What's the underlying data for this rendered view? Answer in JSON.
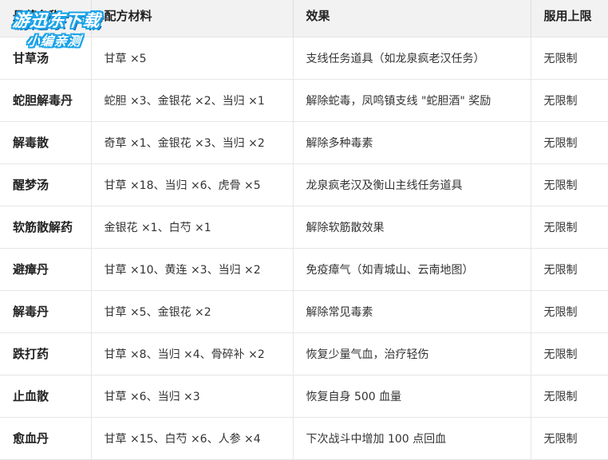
{
  "table": {
    "headers": [
      "丹药名称",
      "配方材料",
      "效果",
      "服用上限"
    ],
    "rows": [
      [
        "甘草汤",
        "甘草 ×5",
        "支线任务道具（如龙泉疯老汉任务）",
        "无限制"
      ],
      [
        "蛇胆解毒丹",
        "蛇胆 ×3、金银花 ×2、当归 ×1",
        "解除蛇毒，凤鸣镇支线 \"蛇胆酒\" 奖励",
        "无限制"
      ],
      [
        "解毒散",
        "奇草 ×1、金银花 ×3、当归 ×2",
        "解除多种毒素",
        "无限制"
      ],
      [
        "醒梦汤",
        "甘草 ×18、当归 ×6、虎骨 ×5",
        "龙泉疯老汉及衡山主线任务道具",
        "无限制"
      ],
      [
        "软筋散解药",
        "金银花 ×1、白芍 ×1",
        "解除软筋散效果",
        "无限制"
      ],
      [
        "避瘴丹",
        "甘草 ×10、黄连 ×3、当归 ×2",
        "免疫瘴气（如青城山、云南地图）",
        "无限制"
      ],
      [
        "解毒丹",
        "甘草 ×5、金银花 ×2",
        "解除常见毒素",
        "无限制"
      ],
      [
        "跌打药",
        "甘草 ×8、当归 ×4、骨碎补 ×2",
        "恢复少量气血，治疗轻伤",
        "无限制"
      ],
      [
        "止血散",
        "甘草 ×6、当归 ×3",
        "恢复自身 500 血量",
        "无限制"
      ],
      [
        "愈血丹",
        "甘草 ×15、白芍 ×6、人参 ×4",
        "下次战斗中增加 100 点回血",
        "无限制"
      ]
    ]
  },
  "watermark": {
    "line1": "游迅东下载",
    "line2": "小编亲测"
  },
  "colors": {
    "header_bg": "#f2f2f2",
    "border": "#e6e6e6",
    "text": "#333333",
    "watermark_outline": "#1aa3e8"
  }
}
